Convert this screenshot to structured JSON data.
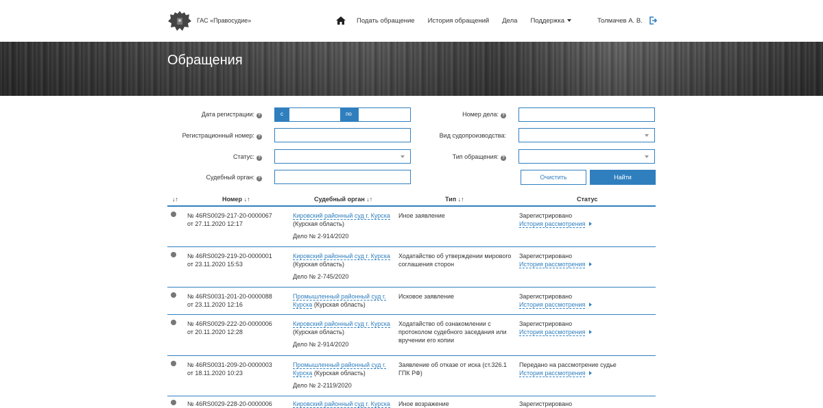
{
  "header": {
    "app_title": "ГАС «Правосудие»",
    "nav": {
      "home_icon": "home-icon",
      "submit": "Подать обращение",
      "history": "История обращений",
      "cases": "Дела",
      "support": "Поддержка"
    },
    "user": "Толмачев А. В.",
    "logout_icon": "logout-icon"
  },
  "banner": {
    "title": "Обращения"
  },
  "filters": {
    "reg_date_label": "Дата регистрации:",
    "date_from_addon": "с",
    "date_to_addon": "по",
    "reg_number_label": "Регистрационный номер:",
    "status_label": "Статус:",
    "court_label": "Судебный орган:",
    "case_number_label": "Номер дела:",
    "proceeding_type_label": "Вид судопроизводства:",
    "appeal_type_label": "Тип обращения:",
    "help_glyph": "?",
    "clear_button": "Очистить",
    "find_button": "Найти"
  },
  "table": {
    "headers": {
      "sort": "↓↑",
      "number": "Номер",
      "court": "Судебный орган",
      "type": "Тип",
      "status": "Статус",
      "sort_glyph": "↓↑"
    },
    "rows": [
      {
        "number": "№ 46RS0029-217-20-0000067",
        "date": "от 27.11.2020 12:17",
        "court_link": "Кировский районный суд г. Курска",
        "region": "(Курская область)",
        "case": "Дело № 2-914/2020",
        "type": "Иное заявление",
        "status": "Зарегистрировано",
        "history": "История рассмотрения"
      },
      {
        "number": "№ 46RS0029-219-20-0000001",
        "date": "от 23.11.2020 15:53",
        "court_link": "Кировский районный суд г. Курска",
        "region": "(Курская область)",
        "case": "Дело № 2-745/2020",
        "type": "Ходатайство об утверждении мирового соглашения сторон",
        "status": "Зарегистрировано",
        "history": "История рассмотрения"
      },
      {
        "number": "№ 46RS0031-201-20-0000088",
        "date": "от 23.11.2020 12:16",
        "court_link": "Промышленный районный суд г. Курска",
        "region": "(Курская область)",
        "case": "",
        "type": "Исковое заявление",
        "status": "Зарегистрировано",
        "history": "История рассмотрения"
      },
      {
        "number": "№ 46RS0029-222-20-0000006",
        "date": "от 20.11.2020 12:28",
        "court_link": "Кировский районный суд г. Курска",
        "region": "(Курская область)",
        "case": "Дело № 2-914/2020",
        "type": "Ходатайство об ознакомлении с протоколом судебного заседания или вручении его копии",
        "status": "Зарегистрировано",
        "history": "История рассмотрения"
      },
      {
        "number": "№ 46RS0031-209-20-0000003",
        "date": "от 18.11.2020 10:23",
        "court_link": "Промышленный районный суд г. Курска",
        "region": "(Курская область)",
        "case": "Дело № 2-2119/2020",
        "type": "Заявление об отказе от иска (ст.326.1 ГПК РФ)",
        "status": "Передано на рассмотрение судье",
        "history": "История рассмотрения"
      },
      {
        "number": "№ 46RS0029-228-20-0000006",
        "date": "",
        "court_link": "Кировский районный суд г. Курска",
        "region": "",
        "case": "",
        "type": "Иное возражение",
        "status": "Зарегистрировано",
        "history": ""
      }
    ]
  }
}
